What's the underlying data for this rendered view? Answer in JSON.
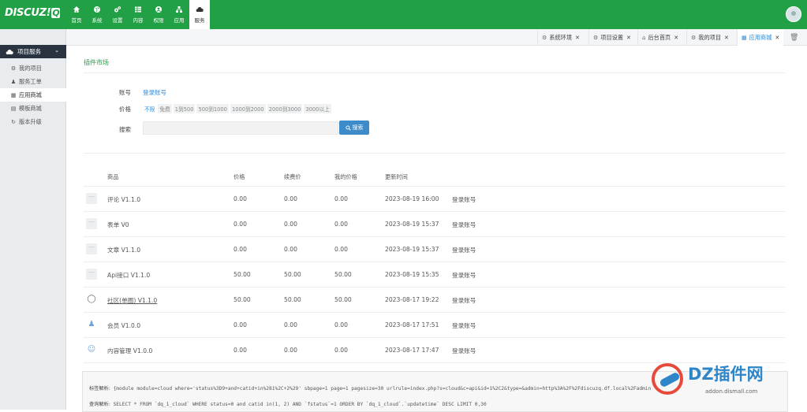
{
  "brand": {
    "logo_text": "DISCUZ!",
    "logo_q": "Q"
  },
  "nav": [
    {
      "label": "首页",
      "icon": "home-icon"
    },
    {
      "label": "系统",
      "icon": "globe-icon"
    },
    {
      "label": "设置",
      "icon": "gears-icon"
    },
    {
      "label": "内容",
      "icon": "grid-icon"
    },
    {
      "label": "权限",
      "icon": "user-circle-icon"
    },
    {
      "label": "应用",
      "icon": "sitemap-icon"
    },
    {
      "label": "服务",
      "icon": "cloud-icon",
      "active": true
    }
  ],
  "sidebar": {
    "section": "项目服务",
    "items": [
      {
        "label": "我的项目",
        "icon": "gear-icon"
      },
      {
        "label": "服务工单",
        "icon": "user-icon"
      },
      {
        "label": "应用商城",
        "icon": "sitemap-icon",
        "active": true
      },
      {
        "label": "模板商城",
        "icon": "template-icon"
      },
      {
        "label": "版本升级",
        "icon": "refresh-icon"
      }
    ]
  },
  "tabs": [
    {
      "label": "系统环境",
      "icon": "gear-icon"
    },
    {
      "label": "项目设置",
      "icon": "gear-icon"
    },
    {
      "label": "后台首页",
      "icon": "home-icon"
    },
    {
      "label": "我的项目",
      "icon": "gear-icon"
    },
    {
      "label": "应用商城",
      "icon": "sitemap-icon",
      "active": true
    }
  ],
  "page": {
    "title": "插件市场",
    "account_label": "账号",
    "account_link": "登录账号",
    "price_label": "价格",
    "price_options": [
      "不限",
      "免费",
      "1到500",
      "500到1000",
      "1000到2000",
      "2000到3000",
      "3000以上"
    ],
    "search_label": "搜索",
    "search_placeholder": "",
    "search_button": "搜索"
  },
  "table": {
    "headers": [
      "商品",
      "价格",
      "续费价",
      "我的价格",
      "更新时间"
    ],
    "rows": [
      {
        "name": "评论 V1.1.0",
        "price": "0.00",
        "renew": "0.00",
        "mine": "0.00",
        "time": "2023-08-19 16:00",
        "action": "登录账号",
        "icon": "placeholder"
      },
      {
        "name": "表单 V0",
        "price": "0.00",
        "renew": "0.00",
        "mine": "0.00",
        "time": "2023-08-19 15:37",
        "action": "登录账号",
        "icon": "placeholder"
      },
      {
        "name": "文章 V1.1.0",
        "price": "0.00",
        "renew": "0.00",
        "mine": "0.00",
        "time": "2023-08-19 15:37",
        "action": "登录账号",
        "icon": "placeholder"
      },
      {
        "name": "Api接口 V1.1.0",
        "price": "50.00",
        "renew": "50.00",
        "mine": "50.00",
        "time": "2023-08-19 15:35",
        "action": "登录账号",
        "icon": "placeholder"
      },
      {
        "name": "社区(单圈) V1.1.0",
        "price": "50.00",
        "renew": "50.00",
        "mine": "50.00",
        "time": "2023-08-17 19:22",
        "action": "登录账号",
        "icon": "chat-icon"
      },
      {
        "name": "会员 V1.0.0",
        "price": "0.00",
        "renew": "0.00",
        "mine": "0.00",
        "time": "2023-08-17 17:51",
        "action": "登录账号",
        "icon": "user-icon"
      },
      {
        "name": "内容管理 V1.0.0",
        "price": "0.00",
        "renew": "0.00",
        "mine": "0.00",
        "time": "2023-08-17 17:47",
        "action": "登录账号",
        "icon": "smiley-icon"
      }
    ]
  },
  "debug": {
    "label1": "标签解析:",
    "text1": "{module module=cloud where='status%3D9+and+catid+in%281%2C+2%29' sbpage=1 page=1 pagesize=30 urlrule=index.php?s=cloud&c=api&id=1%2C2&type=&admin=http%3A%2F%2Fdiscuzq.df.local%2Fadmin",
    "label2": "查询解析:",
    "text2": "SELECT * FROM `dq_1_cloud` WHERE status=0 and catid in(1, 2) AND `fstatus`=1 ORDER BY `dq_1_cloud`.`updatetime` DESC LIMIT 0,30"
  },
  "watermark": {
    "title": "DZ插件网",
    "site": "addon.dismall.com"
  }
}
